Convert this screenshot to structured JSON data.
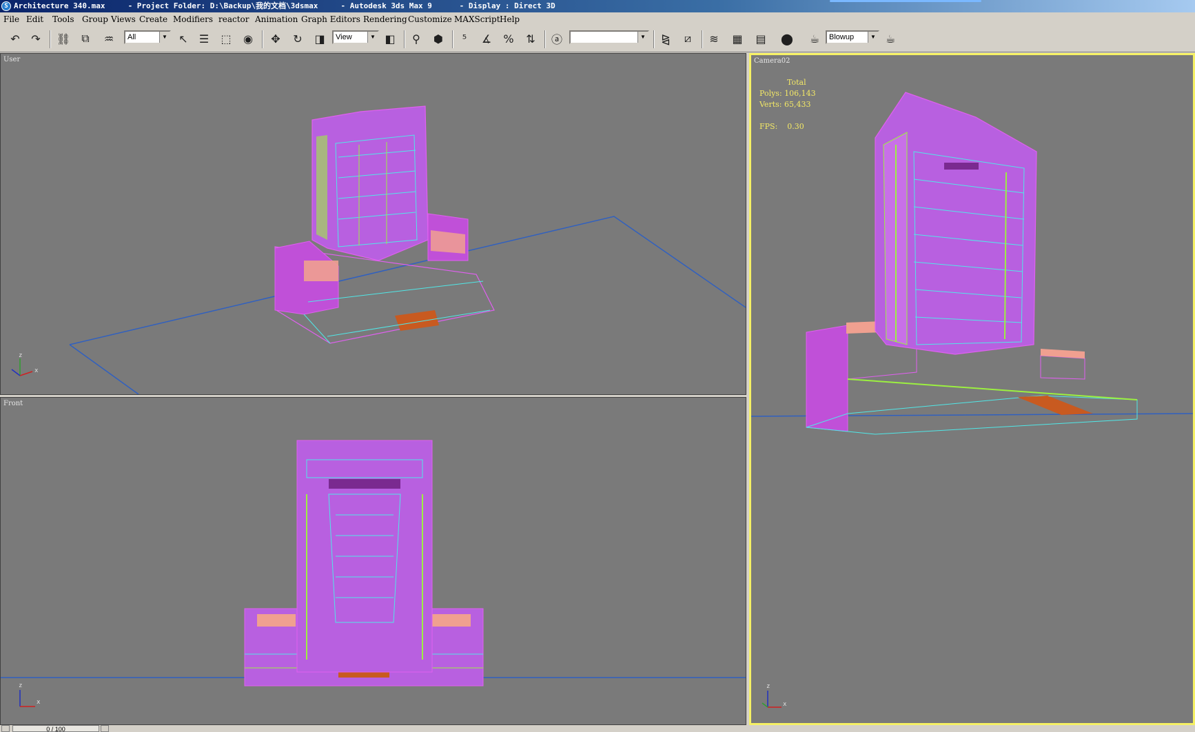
{
  "window": {
    "title": "Architecture 340.max     - Project Folder: D:\\Backup\\我的文档\\3dsmax     - Autodesk 3ds Max 9      - Display : Direct 3D"
  },
  "menu": [
    "File",
    "Edit",
    "Tools",
    "Group",
    "Views",
    "Create",
    "Modifiers",
    "reactor",
    "Animation",
    "Graph Editors",
    "Rendering",
    "Customize",
    "MAXScript",
    "Help"
  ],
  "toolbar": {
    "selection_filter": "All",
    "reference_coord": "View",
    "named_selection": "",
    "render_type": "Blowup",
    "icons": [
      "undo-icon",
      "redo-icon",
      "select-link-icon",
      "unlink-icon",
      "bind-space-warp-icon",
      "select-object-icon",
      "select-by-name-icon",
      "rect-region-icon",
      "window-crossing-icon",
      "move-icon",
      "rotate-icon",
      "scale-icon",
      "use-pivot-icon",
      "select-manipulate-icon",
      "keyboard-shortcut-icon",
      "snap-25-icon",
      "angle-snap-icon",
      "percent-snap-icon",
      "spinner-snap-icon",
      "edit-named-selection-icon",
      "mirror-icon",
      "align-icon",
      "layer-manager-icon",
      "curve-editor-icon",
      "schematic-view-icon",
      "material-editor-icon",
      "render-scene-icon",
      "quick-render-icon"
    ]
  },
  "viewports": {
    "user": {
      "label": "User"
    },
    "front": {
      "label": "Front"
    },
    "camera": {
      "label": "Camera02",
      "stats_total": "Total",
      "stats_polys": "Polys: 106,143",
      "stats_verts": "Verts: 65,433",
      "stats_fps": "FPS:    0.30"
    }
  },
  "axis": {
    "x": "x",
    "z": "z"
  },
  "timeline": {
    "frame": "0 / 100"
  },
  "colors": {
    "wire_magenta": "#e060f0",
    "wire_cyan": "#50e8e8",
    "wire_green": "#9cf040",
    "wire_salmon": "#f0a090",
    "wire_blue": "#3060c0",
    "accent_orange": "#c85a20",
    "active_border": "#f5f064",
    "viewport_bg": "#7a7a7a"
  }
}
